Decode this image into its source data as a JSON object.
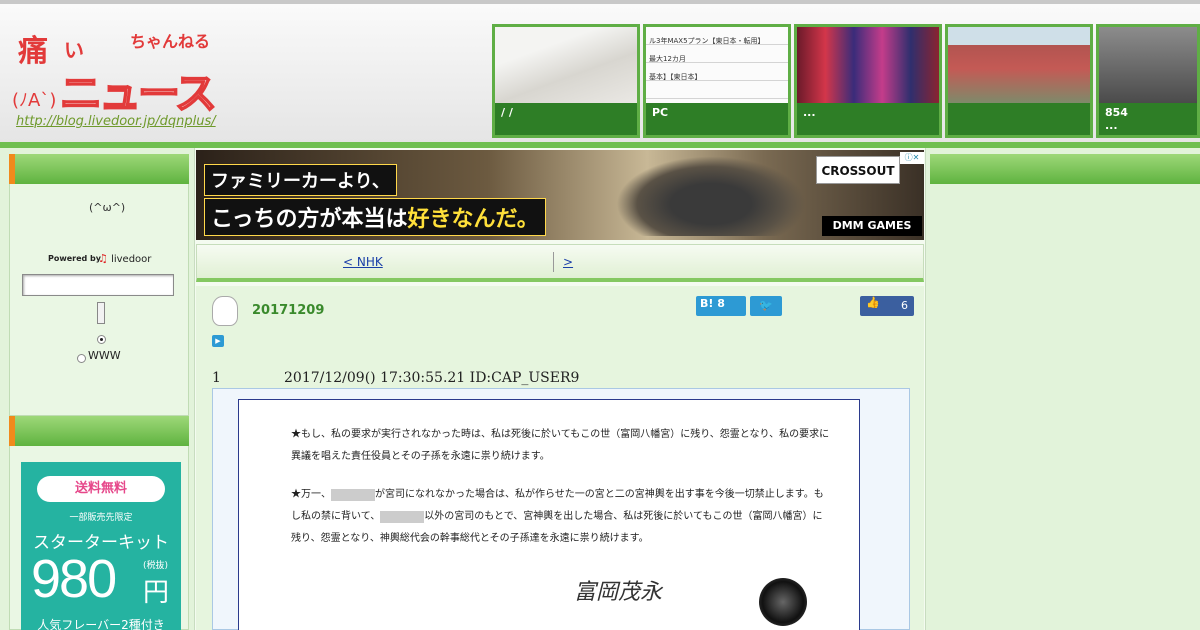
{
  "header": {
    "logo_l1": "痛",
    "logo_l1b": "い",
    "logo_l2": "ちゃんねる",
    "logo_l3": "ニュース",
    "logo_face": "(ﾉA`)",
    "logo_url": "http://blog.livedoor.jp/dqnplus/",
    "thumbs": [
      {
        "caption": "/ /"
      },
      {
        "caption": "PC",
        "text": [
          "ル3年MAX5プラン【東日本・転用】",
          "最大12カ月",
          "基本】【東日本】"
        ]
      },
      {
        "caption": "..."
      },
      {
        "caption": ""
      },
      {
        "caption": "854\n..."
      }
    ]
  },
  "sidebar": {
    "face": "(^ω^)",
    "powered_by": "Powered by",
    "livedoor": "livedoor",
    "search_value": "",
    "radio_www": "WWW"
  },
  "ad_side": {
    "pill": "送料無料",
    "sub1": "一部販売先限定",
    "sub2": "スターターキット",
    "price": "980",
    "yen": "円",
    "tax": "(税抜)",
    "sub3": "人気フレーバー2種付き"
  },
  "banner": {
    "line1": "ファミリーカーより、",
    "line2a": "こっちの方が本当は",
    "line2b": "好きなんだ。",
    "brand": "CROSSOUT",
    "dmm": "DMM GAMES"
  },
  "nav": {
    "prev": "< NHK",
    "next": ">"
  },
  "article": {
    "date": "20171209",
    "hatena_label": "B!",
    "hatena_count": "8",
    "like_count": "6",
    "res_num": "1",
    "res_head": "2017/12/09() 17:30:55.21 ID:CAP_USER9",
    "doc_p1": "★もし、私の要求が実行されなかった時は、私は死後に於いてもこの世（富岡八幡宮）に残り、怨霊となり、私の要求に異議を唱えた責任役員とその子孫を永遠に祟り続けます。",
    "doc_p2a": "★万一、",
    "doc_p2b": "が宮司になれなかった場合は、私が作らせた一の宮と二の宮神輿を出す事を今後一切禁止します。もし私の禁に背いて、",
    "doc_p2c": "以外の宮司のもとで、宮神輿を出した場合、私は死後に於いてもこの世（富岡八幡宮）に残り、怨霊となり、神輿総代会の幹事総代とその子孫達を永遠に祟り続けます。",
    "signature": "富岡茂永"
  }
}
